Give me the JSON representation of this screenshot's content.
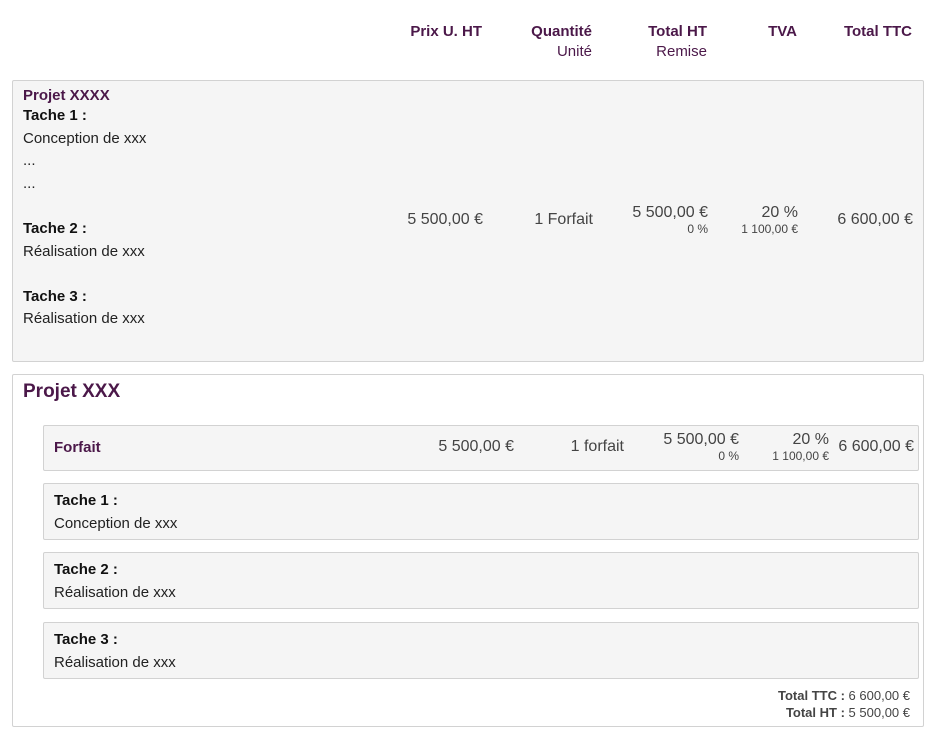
{
  "header": {
    "unit_price": "Prix U. HT",
    "quantity": "Quantité",
    "unit": "Unité",
    "total_ht": "Total HT",
    "discount": "Remise",
    "vat": "TVA",
    "total_ttc": "Total TTC"
  },
  "section1": {
    "title": "Projet XXXX",
    "lines": [
      {
        "label": "Tache 1 :",
        "text": "Conception de xxx"
      },
      {
        "text": "..."
      },
      {
        "text": "..."
      },
      {
        "label": "Tache 2 :",
        "text": "Réalisation de xxx"
      },
      {
        "label": "Tache 3 :",
        "text": "Réalisation de xxx"
      }
    ],
    "unit_price": "5 500,00 €",
    "quantity": "1 Forfait",
    "total_ht": "5 500,00 €",
    "discount": "0 %",
    "vat_rate": "20 %",
    "vat_amount": "1 100,00 €",
    "total_ttc": "6 600,00 €"
  },
  "section2": {
    "title": "Projet XXX",
    "forfait": {
      "label": "Forfait",
      "unit_price": "5 500,00 €",
      "quantity": "1 forfait",
      "total_ht": "5 500,00 €",
      "discount": "0 %",
      "vat_rate": "20 %",
      "vat_amount": "1 100,00 €",
      "total_ttc": "6 600,00 €"
    },
    "tasks": [
      {
        "label": "Tache 1 :",
        "text": "Conception de xxx"
      },
      {
        "label": "Tache 2 :",
        "text": "Réalisation de xxx"
      },
      {
        "label": "Tache 3 :",
        "text": "Réalisation de xxx"
      }
    ],
    "totals": {
      "ttc_label": "Total TTC :",
      "ttc_value": "6 600,00 €",
      "ht_label": "Total HT :",
      "ht_value": "5 500,00 €"
    }
  }
}
